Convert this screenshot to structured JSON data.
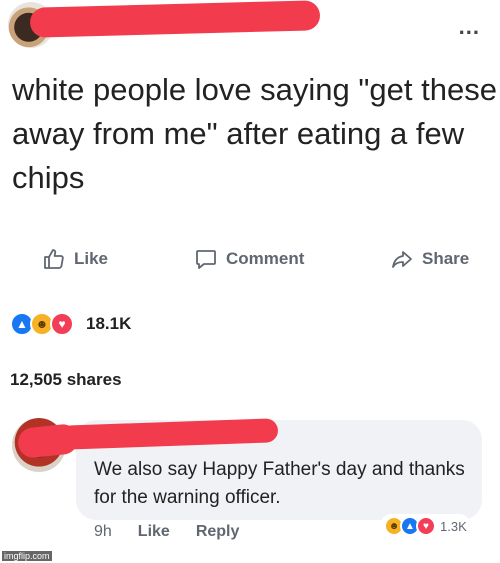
{
  "post": {
    "more_label": "...",
    "text": "white people love saying \"get these away from me\" after eating a few chips",
    "actions": {
      "like": "Like",
      "comment": "Comment",
      "share": "Share"
    },
    "reaction_count": "18.1K",
    "shares": "12,505 shares"
  },
  "comment": {
    "text": "We also say Happy Father's day and thanks for the warning officer.",
    "time": "9h",
    "like": "Like",
    "reply": "Reply",
    "reaction_count": "1.3K"
  },
  "watermark": "imgflip.com",
  "icons": {
    "like": "thumbs-up-icon",
    "comment": "speech-bubble-icon",
    "share": "share-arrow-icon",
    "reactions": [
      "like-reaction-icon",
      "haha-reaction-icon",
      "love-reaction-icon"
    ]
  },
  "colors": {
    "like_blue": "#1877f2",
    "haha_yellow": "#f7b125",
    "love_red": "#f33e58",
    "redaction": "#f23b4c"
  }
}
